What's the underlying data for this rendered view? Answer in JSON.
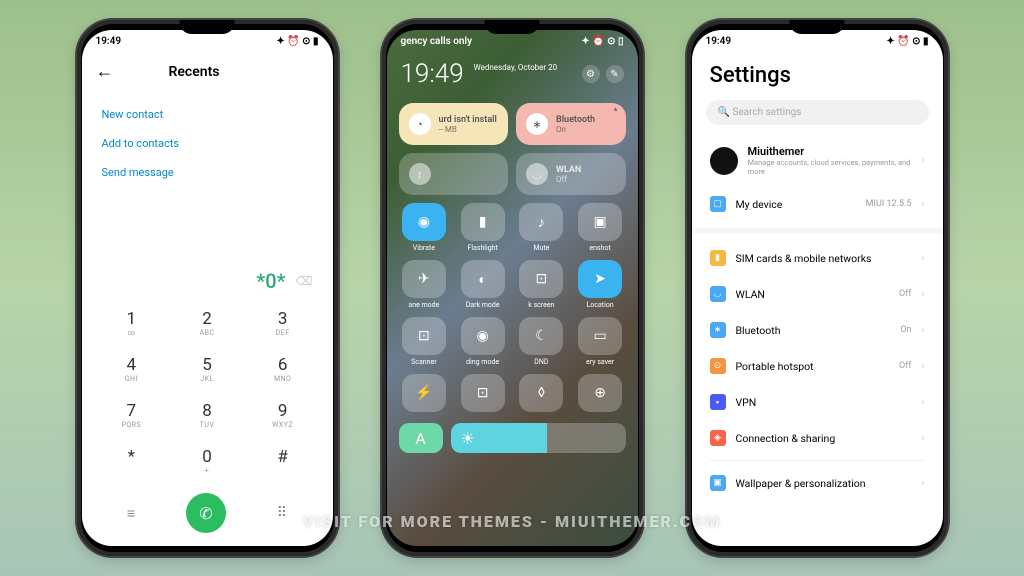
{
  "status": {
    "time": "19:49"
  },
  "dialer": {
    "title": "Recents",
    "actions": [
      "New contact",
      "Add to contacts",
      "Send message"
    ],
    "entered": "*0*",
    "keys": [
      {
        "n": "1",
        "s": "∞"
      },
      {
        "n": "2",
        "s": "ABC"
      },
      {
        "n": "3",
        "s": "DEF"
      },
      {
        "n": "4",
        "s": "GHI"
      },
      {
        "n": "5",
        "s": "JKL"
      },
      {
        "n": "6",
        "s": "MNO"
      },
      {
        "n": "7",
        "s": "PQRS"
      },
      {
        "n": "8",
        "s": "TUV"
      },
      {
        "n": "9",
        "s": "WXYZ"
      },
      {
        "n": "*",
        "s": ""
      },
      {
        "n": "0",
        "s": "+"
      },
      {
        "n": "#",
        "s": ""
      }
    ]
  },
  "cc": {
    "status_text": "gency calls only",
    "time": "19:49",
    "date": "Wednesday, October 20",
    "big_tiles": [
      {
        "title": "urd isn't install",
        "sub": "-- MB",
        "style": "t-data",
        "icon": "◔"
      },
      {
        "title": "Bluetooth",
        "sub": "On",
        "style": "t-bt",
        "icon": "∗"
      },
      {
        "title": "",
        "sub": "",
        "style": "t-dim",
        "icon": "↕"
      },
      {
        "title": "WLAN",
        "sub": "Off",
        "style": "t-dim",
        "icon": "◡"
      }
    ],
    "toggles": [
      {
        "label": "Vibrate",
        "icon": "◉",
        "active": true
      },
      {
        "label": "Flashlight",
        "icon": "▮",
        "active": false
      },
      {
        "label": "Mute",
        "icon": "♪",
        "active": false
      },
      {
        "label": "enshot",
        "icon": "▣",
        "active": false
      },
      {
        "label": "ane mode",
        "icon": "✈",
        "active": false
      },
      {
        "label": "Dark mode",
        "icon": "◐",
        "active": false
      },
      {
        "label": "k screen",
        "icon": "⊡",
        "active": false
      },
      {
        "label": "Location",
        "icon": "➤",
        "active": true
      },
      {
        "label": "Scanner",
        "icon": "⊡",
        "active": false
      },
      {
        "label": "ding mode",
        "icon": "◉",
        "active": false
      },
      {
        "label": "DND",
        "icon": "☾",
        "active": false
      },
      {
        "label": "ery saver",
        "icon": "▭",
        "active": false
      }
    ],
    "auto_label": "A"
  },
  "settings": {
    "title": "Settings",
    "search": "Search settings",
    "profile": {
      "name": "Miuithemer",
      "desc": "Manage accounts, cloud services, payments, and more"
    },
    "my_device": {
      "label": "My device",
      "val": "MIUI 12.5.5",
      "color": "#4aa8f5",
      "icon": "▢"
    },
    "items": [
      {
        "label": "SIM cards & mobile networks",
        "val": "",
        "color": "#f5b942",
        "icon": "▮"
      },
      {
        "label": "WLAN",
        "val": "Off",
        "color": "#4aa8f5",
        "icon": "◡"
      },
      {
        "label": "Bluetooth",
        "val": "On",
        "color": "#4aa8f5",
        "icon": "∗"
      },
      {
        "label": "Portable hotspot",
        "val": "Off",
        "color": "#f59542",
        "icon": "⊙"
      },
      {
        "label": "VPN",
        "val": "",
        "color": "#4a5bf5",
        "icon": "▪"
      },
      {
        "label": "Connection & sharing",
        "val": "",
        "color": "#f5654a",
        "icon": "◈"
      }
    ],
    "wallpaper": {
      "label": "Wallpaper & personalization",
      "color": "#4aa8f5",
      "icon": "▣"
    }
  },
  "watermark": "VISIT FOR MORE THEMES - MIUITHEMER.COM"
}
